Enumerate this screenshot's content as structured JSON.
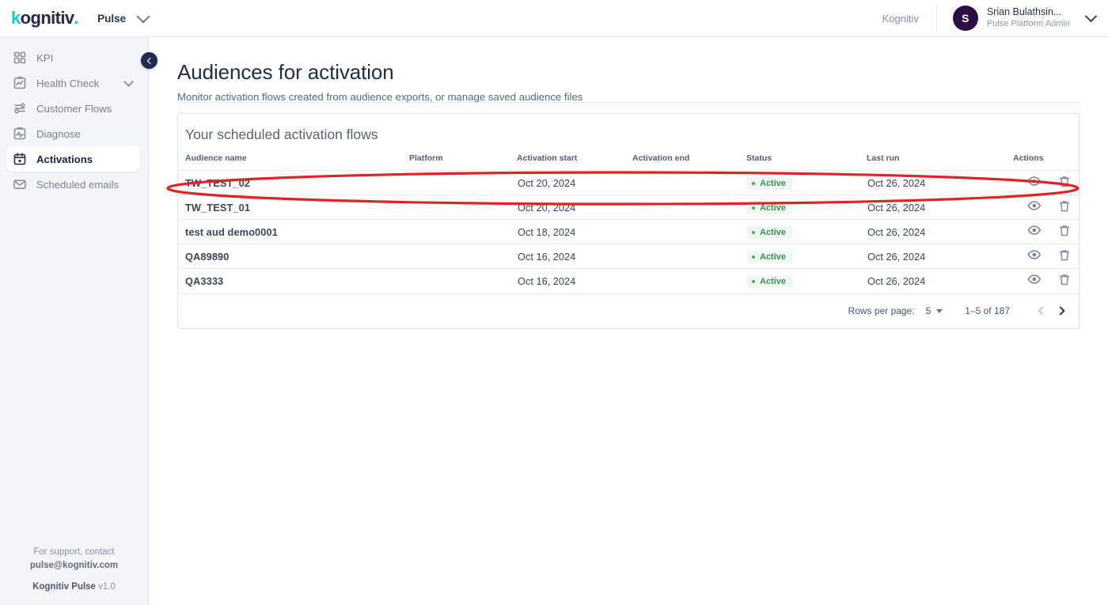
{
  "topbar": {
    "logo_text": "kognitiv",
    "logo_k": "k",
    "logo_rest": "ognitiv",
    "logo_dot": ".",
    "app_label": "Pulse",
    "app_caret_icon": "chevron-down-icon",
    "org_name": "Kognitiv",
    "avatar_initial": "S",
    "user_name": "Srian Bulathsin...",
    "user_role": "Pulse Platform Admin",
    "user_caret_icon": "chevron-down-icon"
  },
  "sidebar": {
    "collapse_icon": "chevron-left-icon",
    "items": [
      {
        "label": "KPI",
        "icon": "grid-dashboard-icon",
        "active": false,
        "has_caret": false
      },
      {
        "label": "Health Check",
        "icon": "clipboard-chart-icon",
        "active": false,
        "has_caret": true
      },
      {
        "label": "Customer Flows",
        "icon": "flow-nodes-icon",
        "active": false,
        "has_caret": false
      },
      {
        "label": "Diagnose",
        "icon": "clipboard-pulse-icon",
        "active": false,
        "has_caret": false
      },
      {
        "label": "Activations",
        "icon": "calendar-icon",
        "active": true,
        "has_caret": false
      },
      {
        "label": "Scheduled emails",
        "icon": "envelope-icon",
        "active": false,
        "has_caret": false
      }
    ],
    "footer": {
      "support_line": "For support, contact",
      "support_email": "pulse@kognitiv.com",
      "product_name": "Kognitiv Pulse",
      "version": "v1.0"
    }
  },
  "main": {
    "page_title": "Audiences for activation",
    "page_subtitle": "Monitor activation flows created from audience exports, or manage saved audience files",
    "card_title": "Your scheduled activation flows",
    "columns": [
      "Audience name",
      "Platform",
      "Activation start",
      "Activation end",
      "Status",
      "Last run",
      "Actions"
    ],
    "rows": [
      {
        "name": "TW_TEST_02",
        "platform": "",
        "start": "Oct 20, 2024",
        "end": "",
        "status": "Active",
        "last_run": "Oct 26, 2024",
        "view_icon": "eye-icon",
        "delete_icon": "trash-icon"
      },
      {
        "name": "TW_TEST_01",
        "platform": "",
        "start": "Oct 20, 2024",
        "end": "",
        "status": "Active",
        "last_run": "Oct 26, 2024",
        "view_icon": "eye-icon",
        "delete_icon": "trash-icon"
      },
      {
        "name": "test aud demo0001",
        "platform": "",
        "start": "Oct 18, 2024",
        "end": "",
        "status": "Active",
        "last_run": "Oct 26, 2024",
        "view_icon": "eye-icon",
        "delete_icon": "trash-icon"
      },
      {
        "name": "QA89890",
        "platform": "",
        "start": "Oct 16, 2024",
        "end": "",
        "status": "Active",
        "last_run": "Oct 26, 2024",
        "view_icon": "eye-icon",
        "delete_icon": "trash-icon"
      },
      {
        "name": "QA3333",
        "platform": "",
        "start": "Oct 16, 2024",
        "end": "",
        "status": "Active",
        "last_run": "Oct 26, 2024",
        "view_icon": "eye-icon",
        "delete_icon": "trash-icon"
      }
    ],
    "pagination": {
      "rows_per_page_label": "Rows per page:",
      "rows_per_page_value": "5",
      "range_text": "1–5 of 187",
      "prev_icon": "chevron-left-icon",
      "next_icon": "chevron-right-icon",
      "prev_enabled": false,
      "next_enabled": true
    }
  },
  "annotation": {
    "shape": "ellipse-highlight",
    "color": "#e02424",
    "target_row": "TW_TEST_02"
  },
  "colors": {
    "brand_navy": "#232a4e",
    "brand_teal": "#18c9c9",
    "sidebar_bg": "#f4f5f7",
    "status_green": "#3f8f5c",
    "status_green_bg": "#eef7f0",
    "avatar_purple": "#2d0d44",
    "annotation_red": "#e02424"
  }
}
